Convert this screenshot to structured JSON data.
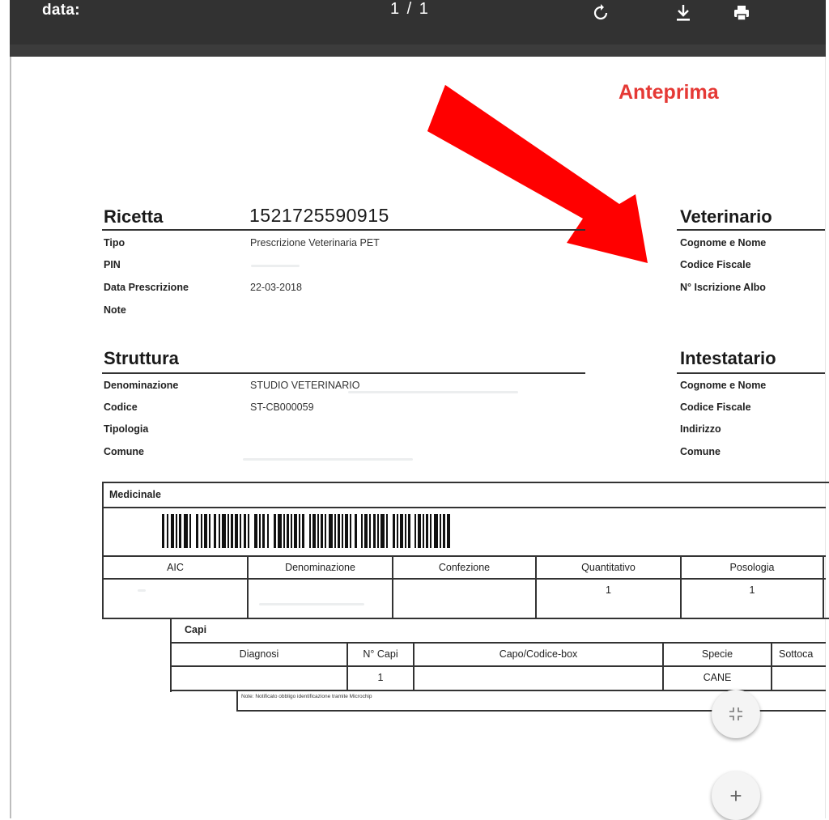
{
  "toolbar": {
    "title": "data:",
    "page_indicator": "1 / 1",
    "icons": [
      "rotate-icon",
      "download-icon",
      "print-icon"
    ]
  },
  "preview_label": "Anteprima",
  "ricetta": {
    "heading": "Ricetta",
    "number": "1521725590915",
    "fields": [
      {
        "label": "Tipo",
        "value": "Prescrizione Veterinaria PET"
      },
      {
        "label": "PIN",
        "value": ""
      },
      {
        "label": "Data Prescrizione",
        "value": "22-03-2018"
      },
      {
        "label": "Note",
        "value": ""
      }
    ]
  },
  "veterinario": {
    "heading": "Veterinario",
    "fields": [
      "Cognome e Nome",
      "Codice Fiscale",
      "N° Iscrizione Albo"
    ]
  },
  "struttura": {
    "heading": "Struttura",
    "fields": [
      {
        "label": "Denominazione",
        "value": "STUDIO VETERINARIO"
      },
      {
        "label": "Codice",
        "value": "ST-CB000059"
      },
      {
        "label": "Tipologia",
        "value": ""
      },
      {
        "label": "Comune",
        "value": ""
      }
    ]
  },
  "intestatario": {
    "heading": "Intestatario",
    "fields": [
      "Cognome e Nome",
      "Codice Fiscale",
      "Indirizzo",
      "Comune"
    ]
  },
  "medicinale": {
    "title": "Medicinale",
    "columns": [
      "AIC",
      "Denominazione",
      "Confezione",
      "Quantitativo",
      "Posologia"
    ],
    "row": [
      "",
      "",
      "",
      "1",
      "1"
    ]
  },
  "capi": {
    "title": "Capi",
    "columns": [
      "Diagnosi",
      "N° Capi",
      "Capo/Codice-box",
      "Specie",
      "Sottoca"
    ],
    "row": [
      "",
      "1",
      "",
      "CANE",
      ""
    ],
    "note": "Note: Notificato obbligo identificazione tramite Microchip"
  },
  "fabs": {
    "fit_icon": "fit-to-page-icon",
    "zoom_in_icon": "zoom-in-icon",
    "zoom_in_symbol": "+"
  },
  "colors": {
    "toolbar": "#323232",
    "accent_red": "#e53935",
    "arrow_red": "#ff0000"
  }
}
